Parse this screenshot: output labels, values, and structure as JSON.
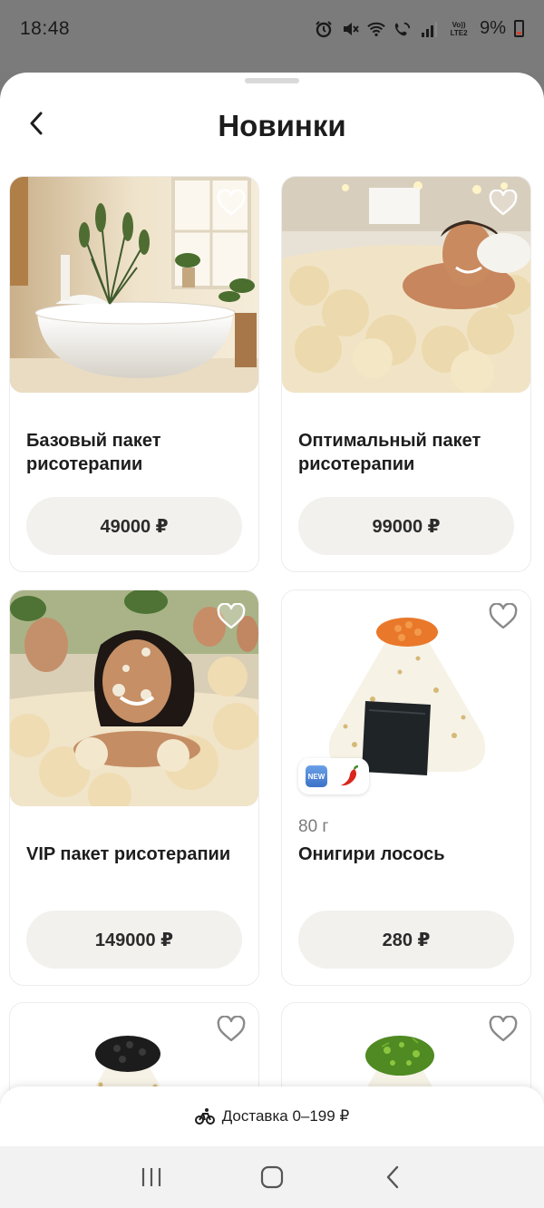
{
  "status_bar": {
    "time": "18:48",
    "battery": "9%",
    "volte": "Vo)) LTE2",
    "icons": [
      "alarm-icon",
      "mute-icon",
      "wifi-icon",
      "wifi-calling-icon",
      "signal-icon",
      "volte-icon",
      "battery-icon"
    ]
  },
  "header": {
    "title": "Новинки",
    "back_icon": "chevron-left-icon"
  },
  "products": [
    {
      "name": "Базовый пакет рисотерапии",
      "price": "49000 ₽",
      "image": "bathtub-room-photo",
      "favorite_icon": "heart-outline-icon"
    },
    {
      "name": "Оптимальный пакет рисотерапии",
      "price": "99000 ₽",
      "image": "man-in-rice-bath-photo",
      "favorite_icon": "heart-outline-icon"
    },
    {
      "name": "VIP пакет рисотерапии",
      "price": "149000 ₽",
      "image": "woman-in-rice-bath-photo",
      "favorite_icon": "heart-outline-icon"
    },
    {
      "weight": "80 г",
      "name": "Онигири лосось",
      "price": "280 ₽",
      "image": "onigiri-salmon-photo",
      "badges": [
        "NEW",
        "chili-pepper-icon"
      ],
      "favorite_icon": "heart-outline-icon"
    },
    {
      "image": "onigiri-black-caviar-photo",
      "favorite_icon": "heart-outline-icon"
    },
    {
      "image": "onigiri-green-onion-photo",
      "favorite_icon": "heart-outline-icon"
    }
  ],
  "delivery": {
    "icon": "bicycle-courier-icon",
    "label": "Доставка 0–199 ₽"
  },
  "navbar": {
    "items": [
      "recent-apps-icon",
      "home-icon",
      "back-icon"
    ]
  },
  "colors": {
    "price_button_bg": "#f2f1ee",
    "status_bar_bg": "#7b7b7b",
    "card_border": "#ececec"
  }
}
